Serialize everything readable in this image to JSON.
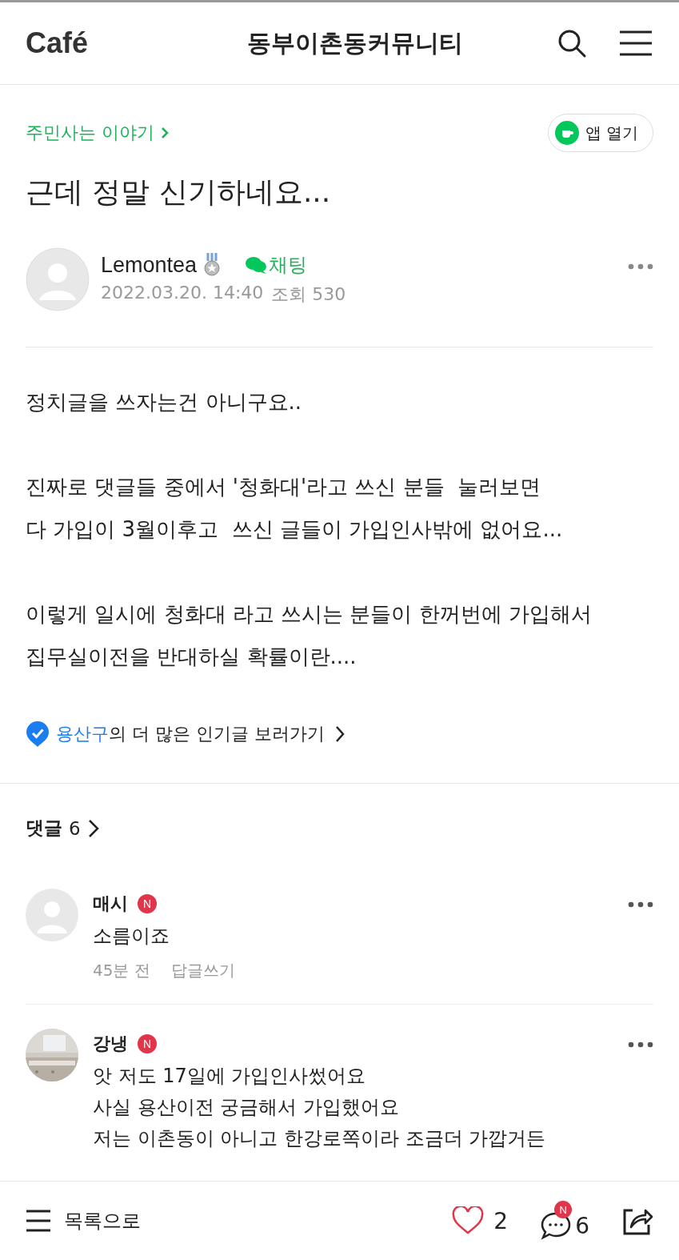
{
  "header": {
    "logo": "Café",
    "title": "동부이촌동커뮤니티"
  },
  "post": {
    "category": "주민사는 이야기",
    "open_app": "앱 열기",
    "title": "근데 정말 신기하네요...",
    "author": {
      "name": "Lemontea",
      "chat": "채팅",
      "date": "2022.03.20. 14:40",
      "views": "조회 530"
    },
    "paragraphs": [
      [
        "정치글을 쓰자는건 아니구요.."
      ],
      [
        "진짜로 댓글들 중에서 '청화대'라고 쓰신 분들  눌러보면",
        "다 가입이 3월이후고  쓰신 글들이 가입인사밖에 없어요..."
      ],
      [
        "이렇게 일시에 청화대 라고 쓰시는 분들이 한꺼번에 가입해서 집무실이전을 반대하실 확률이란...."
      ]
    ],
    "popular": {
      "region": "용산구",
      "text": "의 더 많은 인기글 보러가기"
    }
  },
  "comments_header": {
    "label": "댓글",
    "count": "6"
  },
  "comments": [
    {
      "name": "매시",
      "badge": "N",
      "avatar": {
        "kind": "default"
      },
      "lines": [
        "소름이죠"
      ],
      "time": "45분 전",
      "reply": "답글쓰기"
    },
    {
      "name": "강냉",
      "badge": "N",
      "lines": [
        "앗 저도 17일에 가입인사썼어요",
        "사실 용산이전 궁금해서 가입했어요",
        "저는 이촌동이 아니고 한강로쪽이라 조금더 가깝거든"
      ]
    }
  ],
  "bottom_bar": {
    "list": "목록으로",
    "likes": "2",
    "comments": "6",
    "comments_badge": "N"
  }
}
